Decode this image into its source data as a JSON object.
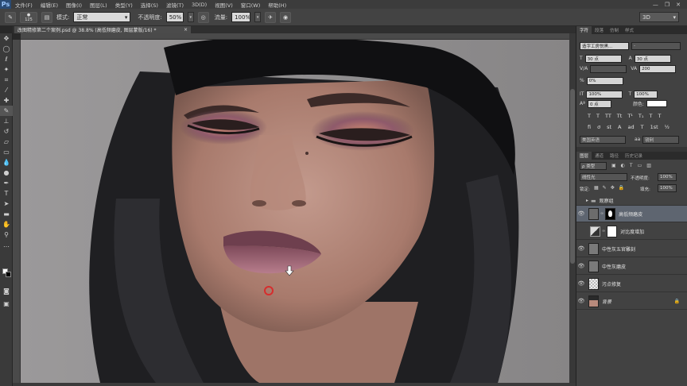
{
  "app": {
    "logo": "Ps"
  },
  "menu": [
    "文件(F)",
    "编辑(E)",
    "图像(I)",
    "图层(L)",
    "类型(Y)",
    "选择(S)",
    "滤镜(T)",
    "3D(D)",
    "视图(V)",
    "窗口(W)",
    "帮助(H)"
  ],
  "window_controls": {
    "minimize": "—",
    "restore": "❐",
    "close": "✕"
  },
  "options": {
    "brush_size": "125",
    "mode_label": "模式:",
    "mode_value": "正常",
    "opacity_label": "不透明度:",
    "opacity_value": "50%",
    "flow_label": "流量:",
    "flow_value": "100%",
    "workspace": "3D"
  },
  "document": {
    "tab_title": "改图精修第二个案例.psd @ 38.8% (高低频磨皮, 图层蒙版/16) *",
    "close": "×"
  },
  "char_panel": {
    "tabs": [
      "字符",
      "段落",
      "仿制",
      "样式"
    ],
    "font_family": "造字工房悦黑...",
    "font_style": "-",
    "font_size": "30 点",
    "leading": "30 点",
    "kerning": "",
    "tracking": "200",
    "scale_pct": "0%",
    "vertical_scale": "100%",
    "horizontal_scale": "100%",
    "baseline": "0 点",
    "color_label": "颜色:",
    "style_buttons_1": [
      "T",
      "T",
      "TT",
      "Tt",
      "T¹",
      "T₁",
      "T",
      "T"
    ],
    "style_buttons_2": [
      "fi",
      "ơ",
      "st",
      "A",
      "ad",
      "T",
      "1st",
      "½"
    ],
    "language": "美国英语",
    "antialias": "锐利"
  },
  "layers_panel": {
    "tabs": [
      "图层",
      "通道",
      "路径",
      "历史记录"
    ],
    "filter_label": "ρ 类型",
    "blend_mode": "线性光",
    "opacity_label": "不透明度:",
    "opacity_value": "100%",
    "lock_label": "锁定:",
    "fill_label": "填充:",
    "fill_value": "100%",
    "group_name": "观察组",
    "layers": [
      {
        "name": "高低频磨皮",
        "selected": true
      },
      {
        "name": "对比度增加",
        "selected": false
      },
      {
        "name": "中性灰五官雕刻",
        "selected": false
      },
      {
        "name": "中性灰磨皮",
        "selected": false
      },
      {
        "name": "污点修复",
        "selected": false
      },
      {
        "name": "背景",
        "selected": false
      }
    ]
  }
}
